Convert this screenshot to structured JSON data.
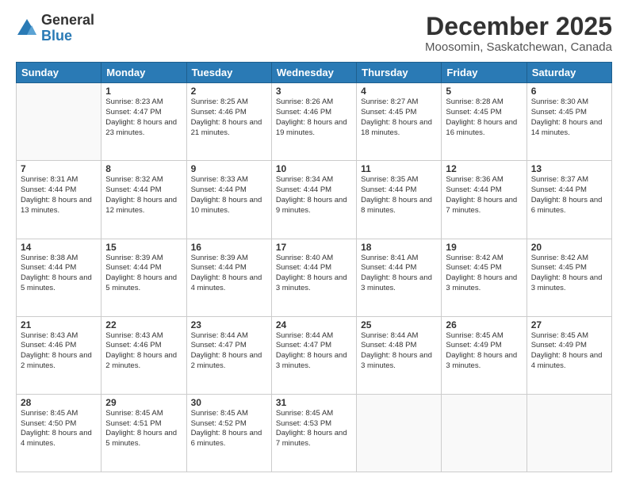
{
  "logo": {
    "general": "General",
    "blue": "Blue"
  },
  "title": {
    "month": "December 2025",
    "location": "Moosomin, Saskatchewan, Canada"
  },
  "weekdays": [
    "Sunday",
    "Monday",
    "Tuesday",
    "Wednesday",
    "Thursday",
    "Friday",
    "Saturday"
  ],
  "weeks": [
    [
      {
        "date": "",
        "sunrise": "",
        "sunset": "",
        "daylight": ""
      },
      {
        "date": "1",
        "sunrise": "Sunrise: 8:23 AM",
        "sunset": "Sunset: 4:47 PM",
        "daylight": "Daylight: 8 hours and 23 minutes."
      },
      {
        "date": "2",
        "sunrise": "Sunrise: 8:25 AM",
        "sunset": "Sunset: 4:46 PM",
        "daylight": "Daylight: 8 hours and 21 minutes."
      },
      {
        "date": "3",
        "sunrise": "Sunrise: 8:26 AM",
        "sunset": "Sunset: 4:46 PM",
        "daylight": "Daylight: 8 hours and 19 minutes."
      },
      {
        "date": "4",
        "sunrise": "Sunrise: 8:27 AM",
        "sunset": "Sunset: 4:45 PM",
        "daylight": "Daylight: 8 hours and 18 minutes."
      },
      {
        "date": "5",
        "sunrise": "Sunrise: 8:28 AM",
        "sunset": "Sunset: 4:45 PM",
        "daylight": "Daylight: 8 hours and 16 minutes."
      },
      {
        "date": "6",
        "sunrise": "Sunrise: 8:30 AM",
        "sunset": "Sunset: 4:45 PM",
        "daylight": "Daylight: 8 hours and 14 minutes."
      }
    ],
    [
      {
        "date": "7",
        "sunrise": "Sunrise: 8:31 AM",
        "sunset": "Sunset: 4:44 PM",
        "daylight": "Daylight: 8 hours and 13 minutes."
      },
      {
        "date": "8",
        "sunrise": "Sunrise: 8:32 AM",
        "sunset": "Sunset: 4:44 PM",
        "daylight": "Daylight: 8 hours and 12 minutes."
      },
      {
        "date": "9",
        "sunrise": "Sunrise: 8:33 AM",
        "sunset": "Sunset: 4:44 PM",
        "daylight": "Daylight: 8 hours and 10 minutes."
      },
      {
        "date": "10",
        "sunrise": "Sunrise: 8:34 AM",
        "sunset": "Sunset: 4:44 PM",
        "daylight": "Daylight: 8 hours and 9 minutes."
      },
      {
        "date": "11",
        "sunrise": "Sunrise: 8:35 AM",
        "sunset": "Sunset: 4:44 PM",
        "daylight": "Daylight: 8 hours and 8 minutes."
      },
      {
        "date": "12",
        "sunrise": "Sunrise: 8:36 AM",
        "sunset": "Sunset: 4:44 PM",
        "daylight": "Daylight: 8 hours and 7 minutes."
      },
      {
        "date": "13",
        "sunrise": "Sunrise: 8:37 AM",
        "sunset": "Sunset: 4:44 PM",
        "daylight": "Daylight: 8 hours and 6 minutes."
      }
    ],
    [
      {
        "date": "14",
        "sunrise": "Sunrise: 8:38 AM",
        "sunset": "Sunset: 4:44 PM",
        "daylight": "Daylight: 8 hours and 5 minutes."
      },
      {
        "date": "15",
        "sunrise": "Sunrise: 8:39 AM",
        "sunset": "Sunset: 4:44 PM",
        "daylight": "Daylight: 8 hours and 5 minutes."
      },
      {
        "date": "16",
        "sunrise": "Sunrise: 8:39 AM",
        "sunset": "Sunset: 4:44 PM",
        "daylight": "Daylight: 8 hours and 4 minutes."
      },
      {
        "date": "17",
        "sunrise": "Sunrise: 8:40 AM",
        "sunset": "Sunset: 4:44 PM",
        "daylight": "Daylight: 8 hours and 3 minutes."
      },
      {
        "date": "18",
        "sunrise": "Sunrise: 8:41 AM",
        "sunset": "Sunset: 4:44 PM",
        "daylight": "Daylight: 8 hours and 3 minutes."
      },
      {
        "date": "19",
        "sunrise": "Sunrise: 8:42 AM",
        "sunset": "Sunset: 4:45 PM",
        "daylight": "Daylight: 8 hours and 3 minutes."
      },
      {
        "date": "20",
        "sunrise": "Sunrise: 8:42 AM",
        "sunset": "Sunset: 4:45 PM",
        "daylight": "Daylight: 8 hours and 3 minutes."
      }
    ],
    [
      {
        "date": "21",
        "sunrise": "Sunrise: 8:43 AM",
        "sunset": "Sunset: 4:46 PM",
        "daylight": "Daylight: 8 hours and 2 minutes."
      },
      {
        "date": "22",
        "sunrise": "Sunrise: 8:43 AM",
        "sunset": "Sunset: 4:46 PM",
        "daylight": "Daylight: 8 hours and 2 minutes."
      },
      {
        "date": "23",
        "sunrise": "Sunrise: 8:44 AM",
        "sunset": "Sunset: 4:47 PM",
        "daylight": "Daylight: 8 hours and 2 minutes."
      },
      {
        "date": "24",
        "sunrise": "Sunrise: 8:44 AM",
        "sunset": "Sunset: 4:47 PM",
        "daylight": "Daylight: 8 hours and 3 minutes."
      },
      {
        "date": "25",
        "sunrise": "Sunrise: 8:44 AM",
        "sunset": "Sunset: 4:48 PM",
        "daylight": "Daylight: 8 hours and 3 minutes."
      },
      {
        "date": "26",
        "sunrise": "Sunrise: 8:45 AM",
        "sunset": "Sunset: 4:49 PM",
        "daylight": "Daylight: 8 hours and 3 minutes."
      },
      {
        "date": "27",
        "sunrise": "Sunrise: 8:45 AM",
        "sunset": "Sunset: 4:49 PM",
        "daylight": "Daylight: 8 hours and 4 minutes."
      }
    ],
    [
      {
        "date": "28",
        "sunrise": "Sunrise: 8:45 AM",
        "sunset": "Sunset: 4:50 PM",
        "daylight": "Daylight: 8 hours and 4 minutes."
      },
      {
        "date": "29",
        "sunrise": "Sunrise: 8:45 AM",
        "sunset": "Sunset: 4:51 PM",
        "daylight": "Daylight: 8 hours and 5 minutes."
      },
      {
        "date": "30",
        "sunrise": "Sunrise: 8:45 AM",
        "sunset": "Sunset: 4:52 PM",
        "daylight": "Daylight: 8 hours and 6 minutes."
      },
      {
        "date": "31",
        "sunrise": "Sunrise: 8:45 AM",
        "sunset": "Sunset: 4:53 PM",
        "daylight": "Daylight: 8 hours and 7 minutes."
      },
      {
        "date": "",
        "sunrise": "",
        "sunset": "",
        "daylight": ""
      },
      {
        "date": "",
        "sunrise": "",
        "sunset": "",
        "daylight": ""
      },
      {
        "date": "",
        "sunrise": "",
        "sunset": "",
        "daylight": ""
      }
    ]
  ]
}
